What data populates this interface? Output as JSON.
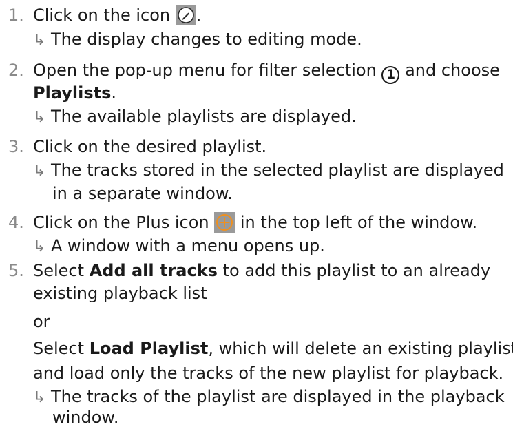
{
  "steps": [
    {
      "number": "1.",
      "text_before": "Click on the icon",
      "icon": "pencil-icon",
      "text_after": ".",
      "result": "The display changes to editing mode."
    },
    {
      "number": "2.",
      "text_before": "Open the pop-up menu for filter selection",
      "marker": "1",
      "text_after": "and choose",
      "bold_line": "Playlists",
      "bold_line_after": ".",
      "result": "The available playlists are displayed."
    },
    {
      "number": "3.",
      "text": "Click on the desired playlist.",
      "result_line1": "The tracks stored in the selected playlist are displayed",
      "result_line2": "in a separate window."
    },
    {
      "number": "4.",
      "text_before": "Click on the Plus icon",
      "icon": "plus-circle-icon",
      "text_after": "in the top left of the window.",
      "result": "A window with a menu opens up."
    },
    {
      "number": "5.",
      "line1_before": "Select",
      "line1_bold": "Add all tracks",
      "line1_after": "to add this playlist to an already",
      "line2": "existing playback list",
      "or": "or",
      "line4_before": "Select",
      "line4_bold": "Load Playlist",
      "line4_after": ", which will delete an existing playlist",
      "line5": "and load only the tracks of the new playlist for playback.",
      "result_line1": "The tracks of the playlist are displayed in the playback",
      "result_line2": "window."
    }
  ],
  "result_arrow": "↳",
  "colors": {
    "text": "#1a1a1a",
    "number": "#8a8a8a",
    "icon_background": "#9a9a9a",
    "plus_icon": "#f0901e"
  }
}
